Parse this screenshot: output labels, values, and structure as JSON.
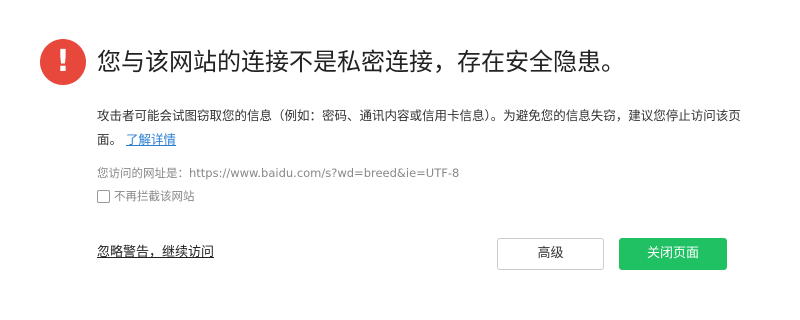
{
  "warning": {
    "icon": "exclamation-icon",
    "icon_glyph": "!",
    "icon_color": "#e8473b"
  },
  "title": "您与该网站的连接不是私密连接，存在安全隐患。",
  "description": {
    "text": "攻击者可能会试图窃取您的信息（例如：密码、通讯内容或信用卡信息）。为避免您的信息失窃，建议您停止访问该页面。",
    "learn_more": "了解详情"
  },
  "url_line": "您访问的网址是：https://www.baidu.com/s?wd=breed&ie=UTF-8",
  "checkbox": {
    "label": "不再拦截该网站",
    "checked": false
  },
  "actions": {
    "ignore_link": "忽略警告，继续访问",
    "advanced_button": "高级",
    "close_button": "关闭页面"
  },
  "colors": {
    "accent_green": "#1fc163",
    "link_blue": "#2a7fd4"
  }
}
